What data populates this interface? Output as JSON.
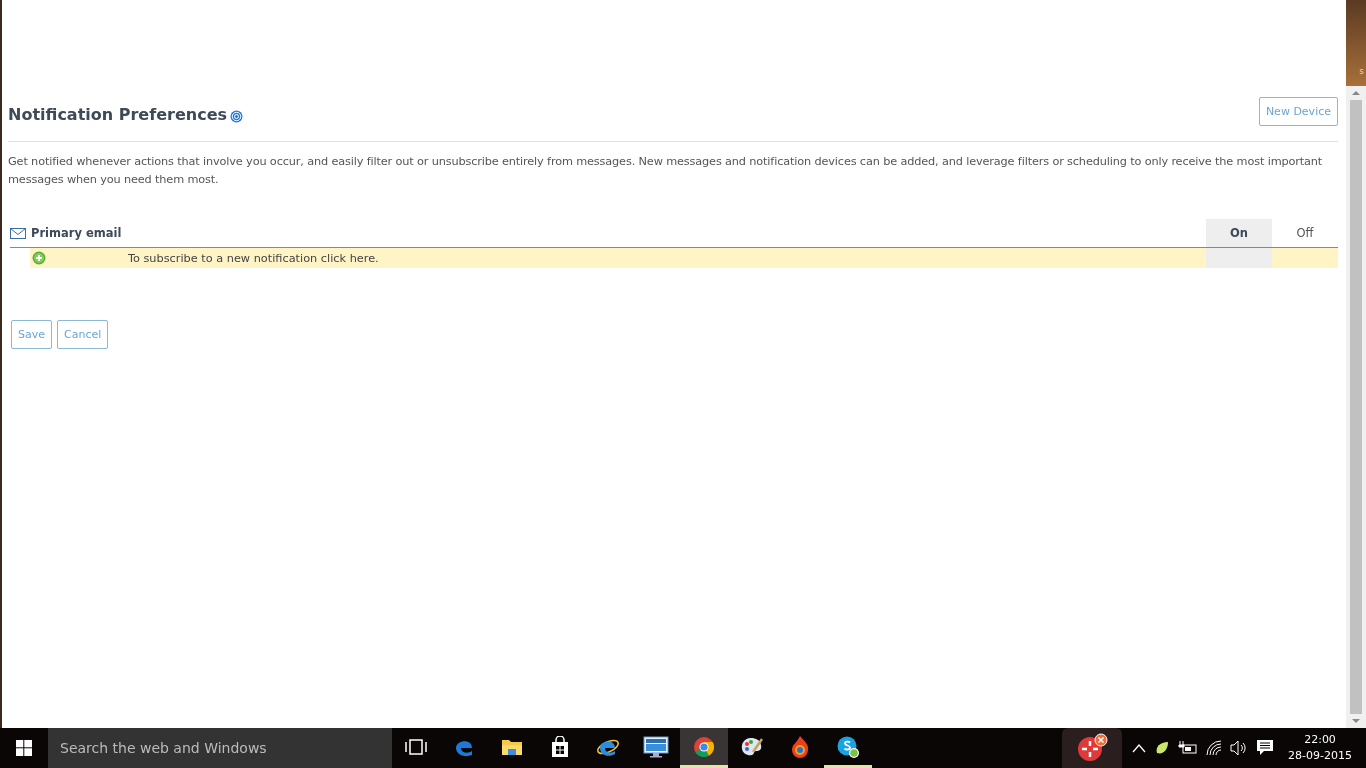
{
  "desktop_edge": {
    "label": "s"
  },
  "page": {
    "title": "Notification Preferences",
    "new_device_button": "New Device",
    "description": "Get notified whenever actions that involve you occur, and easily filter out or unsubscribe entirely from messages. New messages and notification devices can be added, and leverage filters or scheduling to only receive the most important messages when you need them most.",
    "device": {
      "name": "Primary email",
      "columns": [
        {
          "label": "On",
          "selected": true
        },
        {
          "label": "Off",
          "selected": false
        }
      ],
      "subscribe_text": "To subscribe to a new notification click here."
    },
    "buttons": [
      "Save",
      "Cancel"
    ]
  },
  "taskbar": {
    "search": {
      "placeholder": "Search the web and Windows"
    },
    "apps": [
      {
        "kind": "taskview",
        "running": false,
        "active": false
      },
      {
        "kind": "edge",
        "running": false,
        "active": false
      },
      {
        "kind": "folder",
        "running": false,
        "active": false
      },
      {
        "kind": "store",
        "running": false,
        "active": false
      },
      {
        "kind": "ie",
        "running": false,
        "active": false
      },
      {
        "kind": "monitor",
        "running": false,
        "active": false
      },
      {
        "kind": "chrome",
        "running": true,
        "active": true
      },
      {
        "kind": "palette",
        "running": false,
        "active": false
      },
      {
        "kind": "flame",
        "running": false,
        "active": false
      },
      {
        "kind": "skype",
        "running": true,
        "active": false
      }
    ],
    "time": "22:00",
    "date": "28-09-2015"
  }
}
